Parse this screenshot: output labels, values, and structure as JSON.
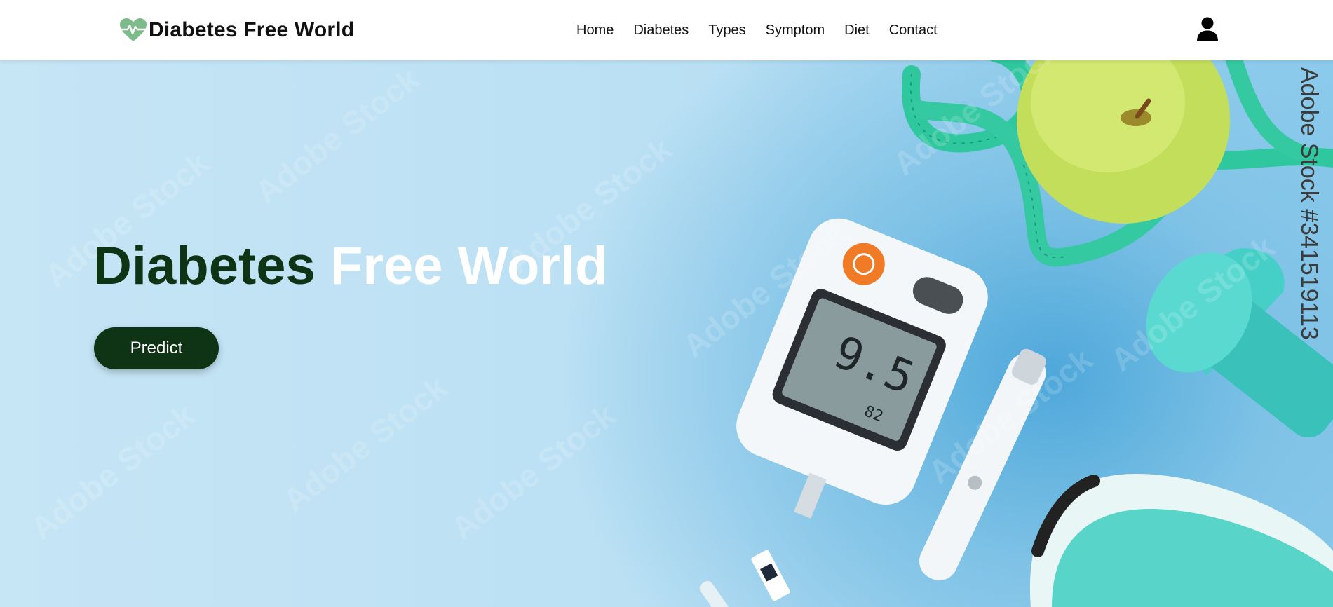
{
  "navbar": {
    "brand": {
      "icon": "heart-pulse-icon",
      "name": "Diabetes Free World"
    },
    "links": [
      "Home",
      "Diabetes",
      "Types",
      "Symptom",
      "Diet",
      "Contact"
    ],
    "user_icon": "user-icon"
  },
  "hero": {
    "title_dark": "Diabetes",
    "title_light": "Free World",
    "predict_label": "Predict",
    "watermark": "Adobe Stock",
    "stock_id": "Adobe Stock #341519113",
    "meter_reading": "9.5",
    "meter_small": "82"
  },
  "colors": {
    "brand_dark_green": "#0e3315",
    "heart_green": "#7dbb8a",
    "background_blue": "#bfe2f4",
    "tape_teal": "#2fc79e"
  }
}
